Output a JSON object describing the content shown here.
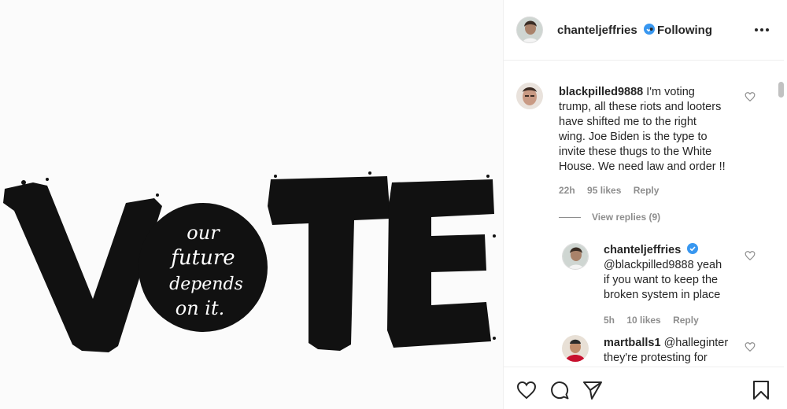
{
  "post": {
    "image_alt": "VOTE",
    "image_words": [
      "our",
      "future",
      "depends",
      "on it."
    ]
  },
  "header": {
    "username": "chanteljeffries",
    "separator": "•",
    "follow_status": "Following",
    "more_icon": "more-horizontal-icon"
  },
  "comments": [
    {
      "username": "blackpilled9888",
      "text_lines": [
        "I'm voting",
        "trump, all these riots and looters",
        "have shifted me to the right",
        "wing. Joe Biden is the type to",
        "invite these thugs to the White",
        "House. We need law and order !!"
      ],
      "time": "22h",
      "likes": "95 likes",
      "reply": "Reply",
      "view_replies": "View replies (9)"
    },
    {
      "username": "chanteljeffries",
      "verified": true,
      "text_lines": [
        "",
        "@blackpilled9888 yeah",
        "if you want to keep the",
        "broken system in place"
      ],
      "time": "5h",
      "likes": "10 likes",
      "reply": "Reply"
    },
    {
      "username": "martballs1",
      "text_lines": [
        "@halleginter",
        "they're protesting for"
      ]
    }
  ],
  "actions": {
    "like_icon": "heart-icon",
    "comment_icon": "comment-icon",
    "share_icon": "share-icon",
    "save_icon": "bookmark-icon"
  },
  "colors": {
    "text": "#262626",
    "muted": "#8e8e8e",
    "border": "#efefef",
    "verified": "#3897f0",
    "ink": "#111111"
  }
}
